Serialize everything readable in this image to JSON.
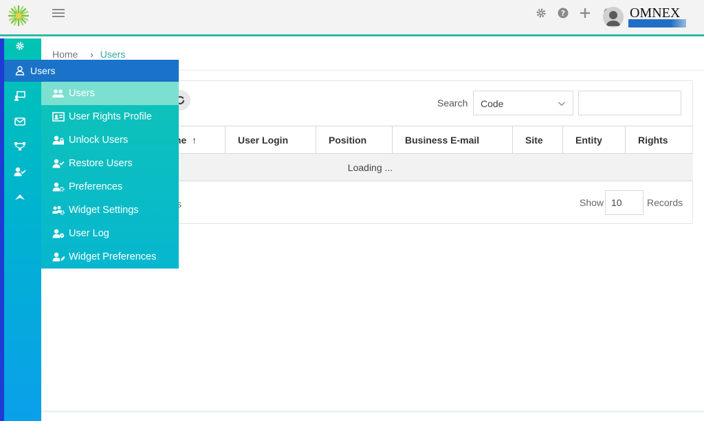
{
  "header": {
    "brand": "OMNEX",
    "icons": [
      "gear-icon",
      "help-icon",
      "plus-icon",
      "bell-icon"
    ]
  },
  "breadcrumb": {
    "home": "Home",
    "separator": "›",
    "current": "Users"
  },
  "flyout": {
    "title": "Users",
    "items": [
      {
        "label": "Users",
        "icon": "users-icon",
        "active": true
      },
      {
        "label": "User Rights Profile",
        "icon": "id-card-icon"
      },
      {
        "label": "Unlock Users",
        "icon": "user-lock-icon"
      },
      {
        "label": "Restore Users",
        "icon": "user-check-icon"
      },
      {
        "label": "Preferences",
        "icon": "user-cog-icon"
      },
      {
        "label": "Widget Settings",
        "icon": "users-cog-icon"
      },
      {
        "label": "User Log",
        "icon": "user-clock-icon"
      },
      {
        "label": "Widget Preferences",
        "icon": "user-edit-icon"
      }
    ]
  },
  "search": {
    "label": "Search",
    "field_value": "Code",
    "query": ""
  },
  "table": {
    "columns": [
      "me",
      "User Login",
      "Position",
      "Business E-mail",
      "Site",
      "Entity",
      "Rights"
    ],
    "sort_indicator": "↑",
    "loading_text": "Loading ..."
  },
  "footer": {
    "left_text": "s",
    "show_label": "Show",
    "page_size": "10",
    "records_label": "Records"
  },
  "colors": {
    "accent": "#2fb7a8",
    "flyout_head": "#1a73c8",
    "rail_top": "#00c4b4",
    "rail_bottom": "#0aa0ea"
  }
}
